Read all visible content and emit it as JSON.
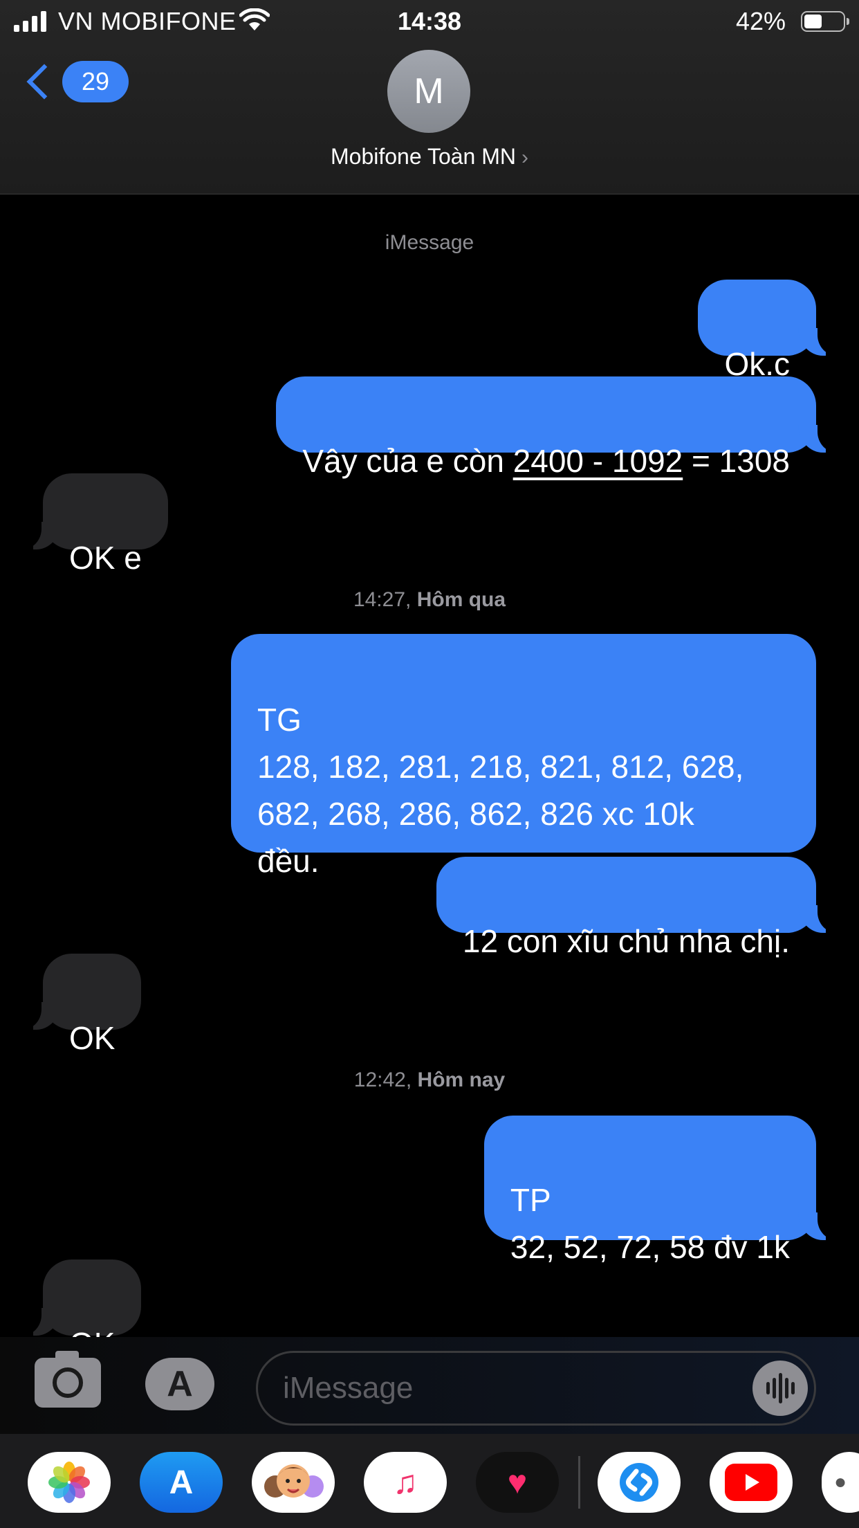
{
  "status_bar": {
    "carrier": "VN MOBIFONE",
    "time": "14:38",
    "battery": "42%",
    "battery_level": 0.42
  },
  "header": {
    "back_count": "29",
    "avatar_initial": "M",
    "contact_name": "Mobifone Toàn MN"
  },
  "conversation": {
    "service_label": "iMessage",
    "date_1": {
      "time": "14:27,",
      "day": "Hôm qua"
    },
    "date_2": {
      "time": "12:42,",
      "day": "Hôm nay"
    },
    "messages": [
      {
        "dir": "out",
        "text": "Ok.c"
      },
      {
        "dir": "out",
        "text_prefix": "Vây của e còn ",
        "text_underlined": "2400 - 1092",
        "text_suffix": " = 1308"
      },
      {
        "dir": "in",
        "text": "OK e"
      },
      {
        "dir": "out",
        "text": "TG\n128, 182, 281, 218, 821, 812, 628,\n682, 268, 286, 862, 826 xc 10k\nđều."
      },
      {
        "dir": "out",
        "text": "12 con xĩu chủ nha chị."
      },
      {
        "dir": "in",
        "text": "OK"
      },
      {
        "dir": "out",
        "text": "TP\n32, 52, 72, 58 đv 1k"
      },
      {
        "dir": "in",
        "text": "OK"
      }
    ]
  },
  "compose": {
    "placeholder": "iMessage"
  },
  "app_drawer": [
    {
      "name": "Photos",
      "icon": "photos-icon"
    },
    {
      "name": "App Store",
      "icon": "app-store-icon"
    },
    {
      "name": "Memoji",
      "icon": "memoji-icon"
    },
    {
      "name": "Music",
      "icon": "music-icon"
    },
    {
      "name": "Digital Touch",
      "icon": "heart-icon"
    },
    {
      "name": "Shazam",
      "icon": "shazam-icon"
    },
    {
      "name": "YouTube",
      "icon": "youtube-icon"
    },
    {
      "name": "More",
      "icon": "more-icon"
    }
  ],
  "colors": {
    "accent": "#3b82f6",
    "incoming_bubble": "#262628",
    "background": "#000000"
  }
}
